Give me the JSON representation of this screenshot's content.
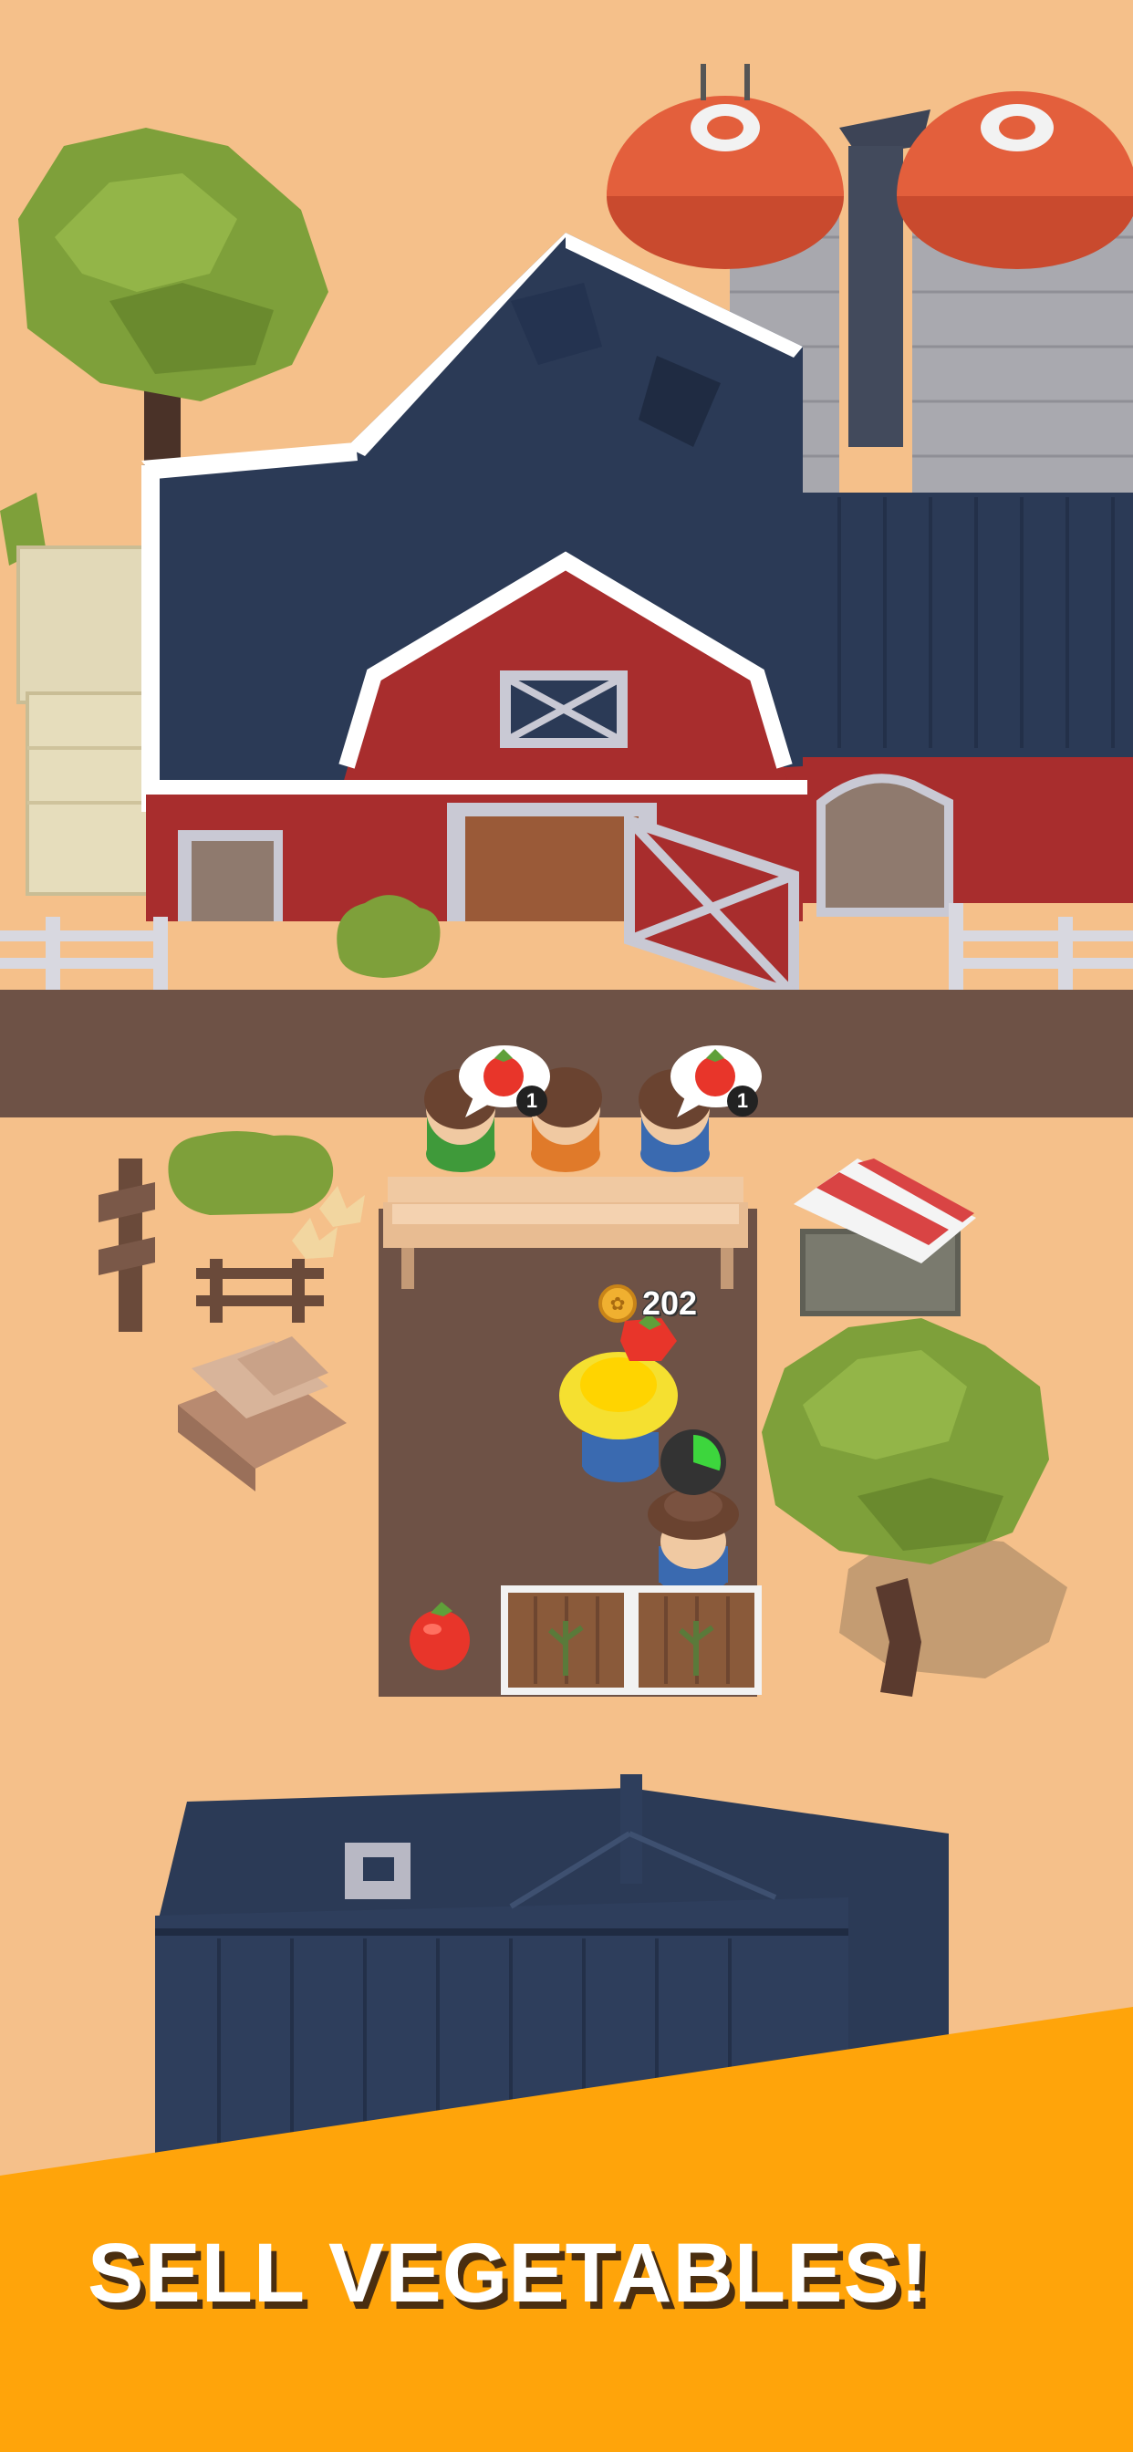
{
  "game": {
    "currency": {
      "count": "202",
      "icon": "coin-icon"
    },
    "customers": [
      {
        "wants_icon": "tomato-icon",
        "quantity": "1"
      },
      {
        "wants_icon": "none",
        "quantity": ""
      },
      {
        "wants_icon": "tomato-icon",
        "quantity": "1"
      }
    ],
    "farm_plots": 2,
    "harvest_progress": 0.3
  },
  "banner": {
    "text": "SELL VEGETABLES!"
  },
  "colors": {
    "ground": "#f5c08a",
    "road": "#6e5246",
    "barn_red": "#a82d2d",
    "roof_navy": "#2b3a56",
    "silo_orange": "#e35f3c",
    "banner_orange": "#ffa40a",
    "tree_green": "#7ea03a"
  }
}
